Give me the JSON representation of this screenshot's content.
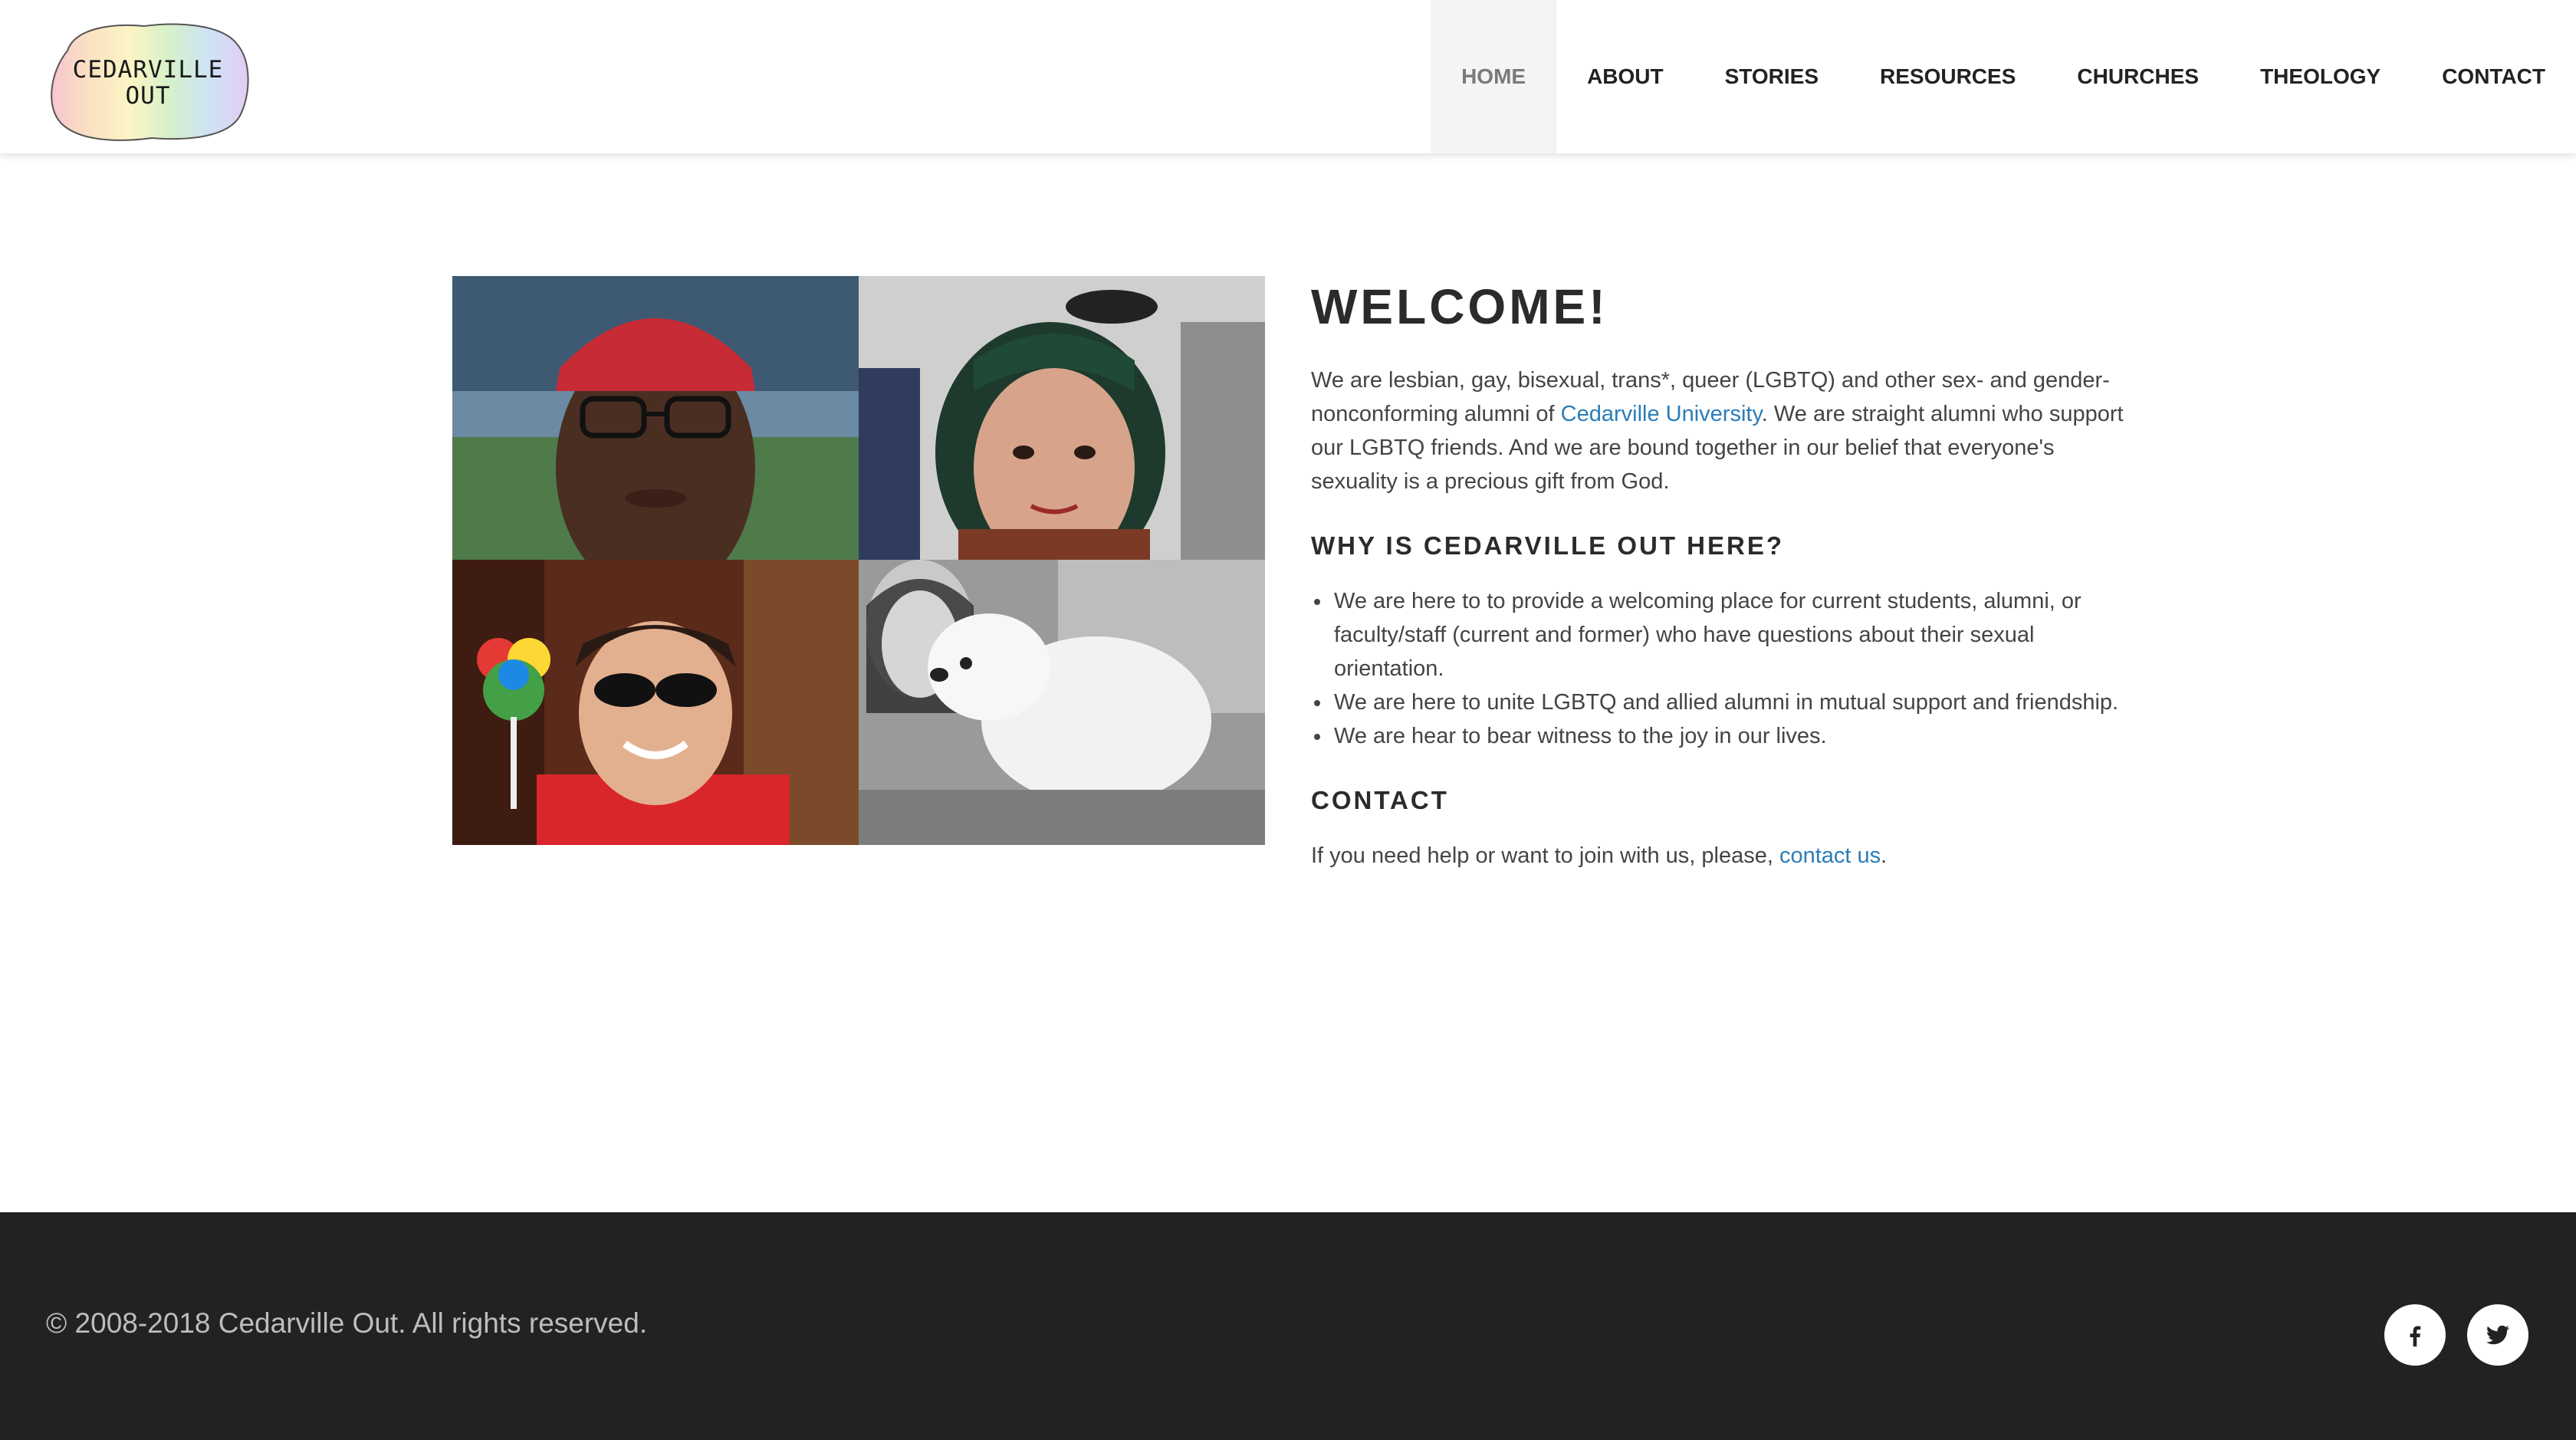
{
  "logo": {
    "line1": "CEDARVILLE",
    "line2": "OUT"
  },
  "nav": {
    "items": [
      {
        "label": "HOME",
        "active": true
      },
      {
        "label": "ABOUT",
        "active": false
      },
      {
        "label": "STORIES",
        "active": false
      },
      {
        "label": "RESOURCES",
        "active": false
      },
      {
        "label": "CHURCHES",
        "active": false
      },
      {
        "label": "THEOLOGY",
        "active": false
      },
      {
        "label": "CONTACT",
        "active": false
      }
    ]
  },
  "main": {
    "title": "WELCOME!",
    "intro": {
      "part1": "We are lesbian, gay, bisexual, trans*, queer (LGBTQ) and other sex- and gender-nonconforming alumni of ",
      "link": "Cedarville University",
      "part2": ". We are straight alumni who support our LGBTQ friends. And we are bound together in our belief that everyone's sexuality is a precious gift from God."
    },
    "why_heading": "WHY IS CEDARVILLE OUT HERE?",
    "reasons": [
      "We are here to to provide a welcoming place for current students, alumni, or faculty/staff (current and former) who have questions about their sexual orientation.",
      "We are here to unite LGBTQ and allied alumni in mutual support and friendship.",
      "We are hear to bear witness to the joy in our lives."
    ],
    "contact_heading": "CONTACT",
    "contact": {
      "text": "If you need help or want to join with us, please, ",
      "link": "contact us",
      "end": "."
    }
  },
  "footer": {
    "copyright": "© 2008-2018 Cedarville Out. All rights reserved.",
    "social": [
      {
        "icon": "facebook-icon"
      },
      {
        "icon": "twitter-icon"
      }
    ]
  },
  "colors": {
    "link": "#2a7db8",
    "footer_bg": "#222222",
    "nav_active_bg": "#f4f4f4",
    "heading": "#2b2b2b"
  }
}
